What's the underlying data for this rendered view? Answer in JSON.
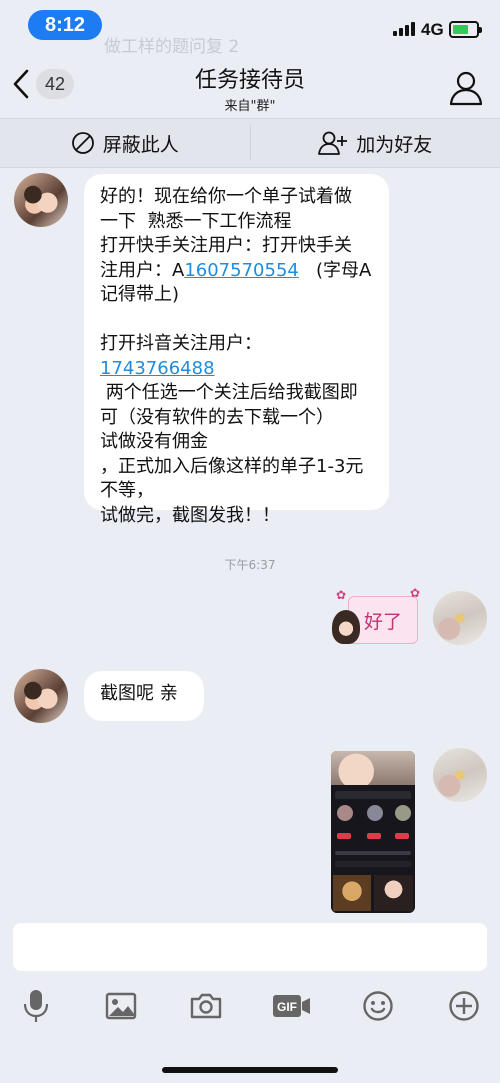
{
  "status_bar": {
    "time": "8:12",
    "faded_text": "做工样的题问复 2",
    "network": "4G"
  },
  "nav": {
    "unread_count": "42",
    "title": "任务接待员",
    "subtitle": "来自\"群\""
  },
  "actions": {
    "block_label": "屏蔽此人",
    "add_friend_label": "加为好友"
  },
  "messages": {
    "first": {
      "line1": "好的！现在给你一个单子试着做\n一下  熟悉一下工作流程\n打开快手关注用户：打开快手关\n注用户：A",
      "link1": "1607570554",
      "line2": "   (字母A\n记得带上)\n\n打开抖音关注用户：",
      "link2": "1743766488",
      "line3": "\n 两个任选一个关注后给我截图即\n可（没有软件的去下载一个）\n试做没有佣金\n，正式加入后像这样的单子1-3元\n不等，\n试做完，截图发我！！"
    },
    "timestamp": "下午6:37",
    "sticker_text": "好了",
    "second": "截图呢 亲"
  },
  "icons": {
    "back": "chevron-left-icon",
    "profile": "person-icon",
    "block": "no-entry-icon",
    "add_friend": "add-person-icon",
    "toolbar": [
      "microphone-icon",
      "image-icon",
      "camera-icon",
      "gif-icon",
      "emoji-icon",
      "plus-circle-icon"
    ]
  },
  "colors": {
    "time_pill": "#1e7cf2",
    "background": "#ebedf4",
    "link": "#1f8ce0",
    "battery": "#34c759"
  }
}
